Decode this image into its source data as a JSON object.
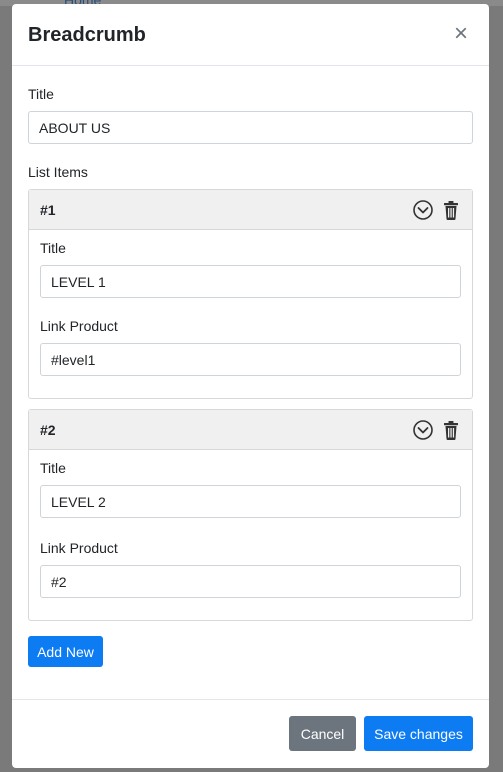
{
  "background": {
    "breadcrumb_home": "Home"
  },
  "modal": {
    "title": "Breadcrumb",
    "close_symbol": "×",
    "title_label": "Title",
    "title_value": "ABOUT US",
    "list_items_label": "List Items",
    "items": [
      {
        "number": "#1",
        "title_label": "Title",
        "title_value": "LEVEL 1",
        "link_label": "Link Product",
        "link_value": "#level1"
      },
      {
        "number": "#2",
        "title_label": "Title",
        "title_value": "LEVEL 2",
        "link_label": "Link Product",
        "link_value": "#2"
      }
    ],
    "add_new_label": "Add New",
    "cancel_label": "Cancel",
    "save_label": "Save changes"
  },
  "colors": {
    "primary": "#0d7bf2",
    "secondary": "#6c757d",
    "card_header": "#f0f0f0"
  },
  "icons": {
    "collapse": "chevron-circle-down-icon",
    "delete": "trash-icon",
    "close": "close-icon"
  }
}
